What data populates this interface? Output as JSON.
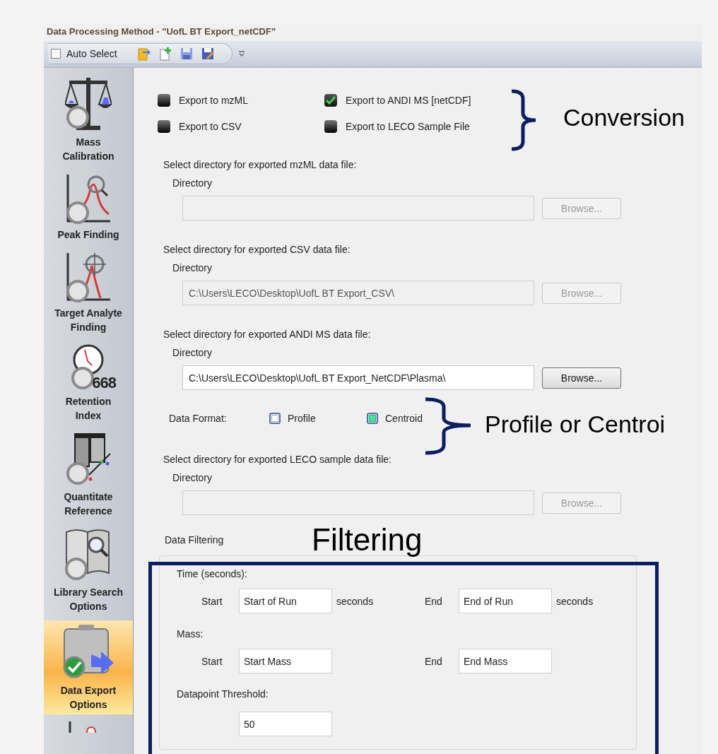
{
  "window": {
    "title": "Data Processing Method - \"UofL BT Export_netCDF\""
  },
  "toolbar": {
    "auto_select": {
      "label": "Auto Select",
      "checked": false
    }
  },
  "sidebar": {
    "items": [
      {
        "kind": "scale",
        "label": "Mass Calibration",
        "selected": false
      },
      {
        "kind": "peak",
        "label": "Peak Finding",
        "selected": false
      },
      {
        "kind": "target",
        "label": "Target Analyte Finding",
        "selected": false
      },
      {
        "kind": "clock",
        "label": "Retention Index",
        "icon_text": "668",
        "selected": false
      },
      {
        "kind": "quant",
        "label": "Quantitate Reference",
        "selected": false
      },
      {
        "kind": "library",
        "label": "Library Search Options",
        "selected": false
      },
      {
        "kind": "export",
        "label": "Data Export Options",
        "selected": true
      },
      {
        "kind": "partial",
        "selected": false
      }
    ]
  },
  "export_options": [
    {
      "label": "Export to mzML",
      "checked": false
    },
    {
      "label": "Export to ANDI MS [netCDF]",
      "checked": true
    },
    {
      "label": "Export to CSV",
      "checked": false
    },
    {
      "label": "Export to LECO Sample File",
      "checked": false
    }
  ],
  "directories": [
    {
      "prompt": "Select directory for exported mzML data file:",
      "label": "Directory",
      "disabled": true,
      "button": "Browse..."
    },
    {
      "prompt": "Select directory for exported CSV data file:",
      "label": "Directory",
      "value": "C:\\Users\\LECO\\Desktop\\UofL BT Export_CSV\\",
      "disabled": true,
      "button": "Browse..."
    },
    {
      "prompt": "Select directory for exported ANDI MS data file:",
      "label": "Directory",
      "value": "C:\\Users\\LECO\\Desktop\\UofL BT Export_NetCDF\\Plasma\\",
      "disabled": false,
      "button": "Browse..."
    },
    {
      "prompt": "Select directory for exported LECO sample data file:",
      "label": "Directory",
      "disabled": true,
      "button": "Browse..."
    }
  ],
  "data_format": {
    "label": "Data Format:",
    "options": [
      {
        "label": "Profile",
        "selected": false
      },
      {
        "label": "Centroid",
        "selected": true
      }
    ]
  },
  "filtering": {
    "title": "Data Filtering",
    "time": {
      "label": "Time (seconds):",
      "start_label": "Start",
      "start_value": "Start of Run",
      "start_unit": "seconds",
      "end_label": "End",
      "end_value": "End of Run",
      "end_unit": "seconds"
    },
    "mass": {
      "label": "Mass:",
      "start_label": "Start",
      "start_value": "Start Mass",
      "end_label": "End",
      "end_value": "End Mass"
    },
    "threshold": {
      "label": "Datapoint Threshold:",
      "value": "50"
    }
  },
  "annotations": {
    "conversion": "Conversion",
    "format": "Profile or Centroi",
    "filtering": "Filtering"
  }
}
